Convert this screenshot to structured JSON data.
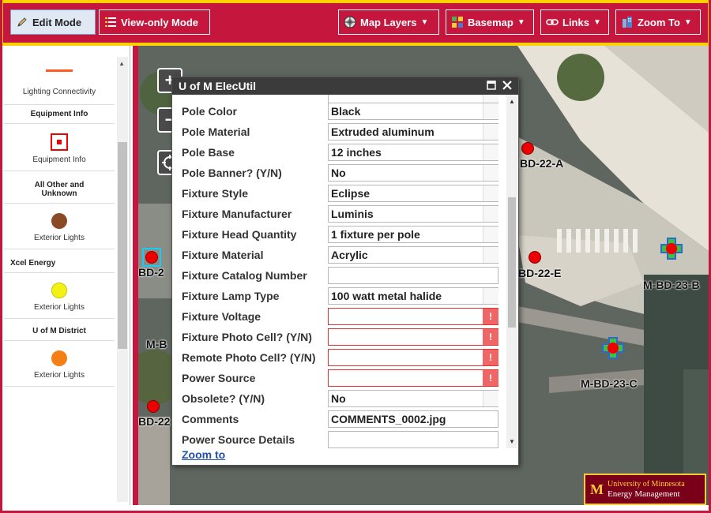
{
  "toolbar": {
    "edit_mode": "Edit Mode",
    "view_only": "View-only Mode",
    "map_layers": "Map Layers",
    "basemap": "Basemap",
    "links": "Links",
    "zoom_to": "Zoom To",
    "caret": "▼"
  },
  "legend": {
    "lighting_connectivity": "Lighting Connectivity",
    "equipment_info_head": "Equipment Info",
    "equipment_info_item": "Equipment Info",
    "all_other_head": "All Other and Unknown",
    "exterior_lights_1": "Exterior Lights",
    "xcel_head": "Xcel Energy",
    "exterior_lights_2": "Exterior Lights",
    "umn_district_head": "U of M District",
    "exterior_lights_3": "Exterior Lights"
  },
  "map": {
    "labels": [
      "BD-22-A",
      "BD-22-E",
      "M-BD-23-B",
      "M-BD-23-C",
      "BD-2",
      "M-B",
      "BD-22"
    ]
  },
  "popup": {
    "title": "U of M ElecUtil",
    "fields": [
      {
        "label": "Pole Color",
        "value": "Black"
      },
      {
        "label": "Pole Material",
        "value": "Extruded aluminum"
      },
      {
        "label": "Pole Base",
        "value": "12 inches"
      },
      {
        "label": "Pole Banner? (Y/N)",
        "value": "No"
      },
      {
        "label": "Fixture Style",
        "value": "Eclipse"
      },
      {
        "label": "Fixture Manufacturer",
        "value": "Luminis"
      },
      {
        "label": "Fixture Head Quantity",
        "value": "1 fixture per pole"
      },
      {
        "label": "Fixture Material",
        "value": "Acrylic"
      },
      {
        "label": "Fixture Catalog Number",
        "value": ""
      },
      {
        "label": "Fixture Lamp Type",
        "value": "100 watt metal halide"
      },
      {
        "label": "Fixture Voltage",
        "value": ""
      },
      {
        "label": "Fixture Photo Cell? (Y/N)",
        "value": ""
      },
      {
        "label": "Remote Photo Cell? (Y/N)",
        "value": ""
      },
      {
        "label": "Power Source",
        "value": ""
      },
      {
        "label": "Obsolete? (Y/N)",
        "value": "No"
      },
      {
        "label": "Comments",
        "value": "COMMENTS_0002.jpg"
      },
      {
        "label": "Power Source Details",
        "value": ""
      }
    ],
    "required_mark": "!",
    "zoom_link": "Zoom to"
  },
  "logo": {
    "line1": "University of Minnesota",
    "line2": "Energy Management"
  }
}
